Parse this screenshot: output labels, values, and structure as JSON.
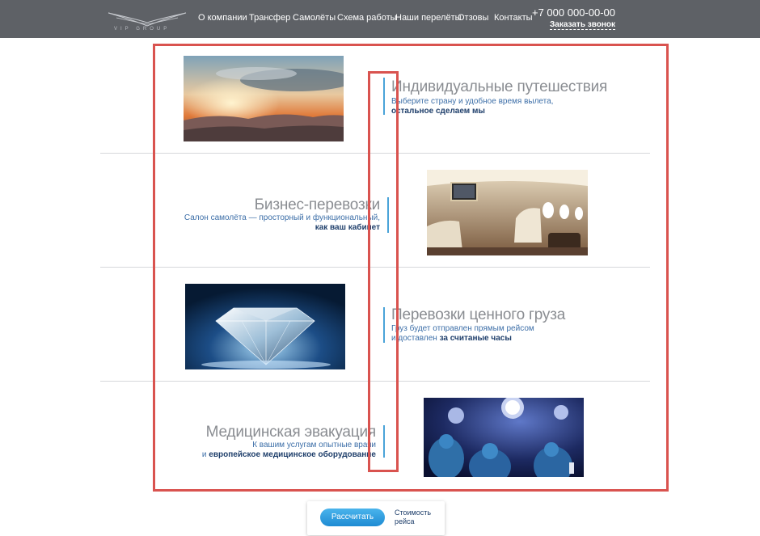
{
  "header": {
    "logo_text": "VIP GROUP",
    "nav": [
      "О компании",
      "Трансфер",
      "Самолёты",
      "Схема работы",
      "Наши перелёты",
      "Отзовы",
      "Контакты"
    ],
    "phone": "+7 000 000-00-00",
    "callback_label": "Заказать звонок"
  },
  "sections": [
    {
      "title": "Индивидуальные путешествия",
      "desc_line1": "Выберите страну и удобное время вылета,",
      "desc_line2_bold": "остальное сделаем мы",
      "image": "sunset-clouds-photo"
    },
    {
      "title": "Бизнес-перевозки",
      "desc_line1": "Салон самолёта — просторный и функциональный,",
      "desc_line2_bold": "как ваш кабинет",
      "image": "jet-cabin-photo"
    },
    {
      "title": "Перевозки ценного груза",
      "desc_line1": "Груз будет отправлен прямым рейсом",
      "desc_line2_plain": "и доставлен ",
      "desc_line2_bold": "за считаные часы",
      "image": "diamond-photo"
    },
    {
      "title": "Медицинская эвакуация",
      "desc_line1": "К вашим услугам опытные врачи",
      "desc_line2_plain": "и ",
      "desc_line2_bold": "европейское медицинское оборудование",
      "image": "surgery-room-photo"
    }
  ],
  "calc": {
    "button_label": "Рассчитать",
    "note_line1": "Стоимость",
    "note_line2": "рейса"
  },
  "colors": {
    "header_bg": "#5e6166",
    "accent": "#4aa3d8",
    "annotation_red": "#d9534f",
    "title_gray": "#8a8d92",
    "desc_blue": "#3d6fa8"
  }
}
